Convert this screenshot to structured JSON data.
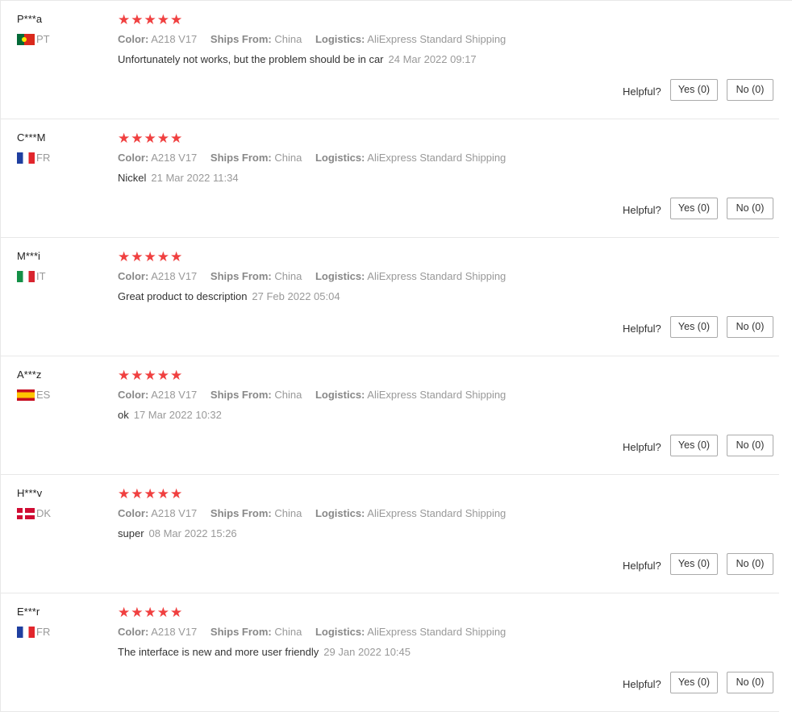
{
  "labels": {
    "color": "Color:",
    "ships_from": "Ships From:",
    "logistics": "Logistics:",
    "helpful": "Helpful?"
  },
  "icons": {
    "star": "star-icon"
  },
  "colors": {
    "star": "#f04040",
    "muted": "#999999"
  },
  "reviews": [
    {
      "user": "P***a",
      "flag": "pt",
      "country": "PT",
      "rating": 5,
      "color": "A218 V17",
      "ships_from": "China",
      "logistics": "AliExpress Standard Shipping",
      "text": "Unfortunately not works, but the problem should be in car",
      "date": "24 Mar 2022 09:17",
      "yes": "Yes (0)",
      "no": "No (0)"
    },
    {
      "user": "C***M",
      "flag": "fr",
      "country": "FR",
      "rating": 5,
      "color": "A218 V17",
      "ships_from": "China",
      "logistics": "AliExpress Standard Shipping",
      "text": "Nickel",
      "date": "21 Mar 2022 11:34",
      "yes": "Yes (0)",
      "no": "No (0)"
    },
    {
      "user": "M***i",
      "flag": "it",
      "country": "IT",
      "rating": 5,
      "color": "A218 V17",
      "ships_from": "China",
      "logistics": "AliExpress Standard Shipping",
      "text": "Great product to description",
      "date": "27 Feb 2022 05:04",
      "yes": "Yes (0)",
      "no": "No (0)"
    },
    {
      "user": "A***z",
      "flag": "es",
      "country": "ES",
      "rating": 5,
      "color": "A218 V17",
      "ships_from": "China",
      "logistics": "AliExpress Standard Shipping",
      "text": "ok",
      "date": "17 Mar 2022 10:32",
      "yes": "Yes (0)",
      "no": "No (0)"
    },
    {
      "user": "H***v",
      "flag": "dk",
      "country": "DK",
      "rating": 5,
      "color": "A218 V17",
      "ships_from": "China",
      "logistics": "AliExpress Standard Shipping",
      "text": "super",
      "date": "08 Mar 2022 15:26",
      "yes": "Yes (0)",
      "no": "No (0)"
    },
    {
      "user": "E***r",
      "flag": "fr",
      "country": "FR",
      "rating": 5,
      "color": "A218 V17",
      "ships_from": "China",
      "logistics": "AliExpress Standard Shipping",
      "text": "The interface is new and more user friendly",
      "date": "29 Jan 2022 10:45",
      "yes": "Yes (0)",
      "no": "No (0)"
    }
  ]
}
